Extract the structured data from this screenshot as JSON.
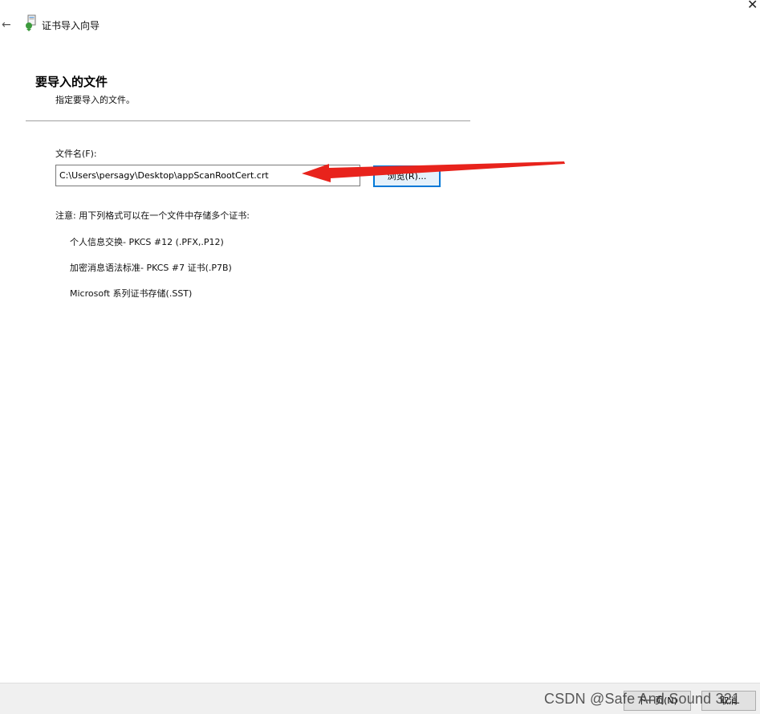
{
  "titlebar": {
    "back_icon": "←",
    "title": "证书导入向导",
    "close_icon": "✕"
  },
  "header": {
    "title": "要导入的文件",
    "subtitle": "指定要导入的文件。"
  },
  "form": {
    "file_label": "文件名(F):",
    "file_value": "C:\\Users\\persagy\\Desktop\\appScanRootCert.crt",
    "browse_label": "浏览(R)..."
  },
  "notes": {
    "intro": "注意: 用下列格式可以在一个文件中存储多个证书:",
    "formats": [
      "个人信息交换- PKCS #12 (.PFX,.P12)",
      "加密消息语法标准- PKCS #7 证书(.P7B)",
      "Microsoft 系列证书存储(.SST)"
    ]
  },
  "footer": {
    "next_label": "下一页(N)",
    "cancel_label": "取消"
  },
  "watermark": "CSDN @Safe And Sound 321",
  "colors": {
    "accent_border": "#0078d7",
    "arrow_red": "#e8231c",
    "footer_bg": "#f0f0f0"
  }
}
